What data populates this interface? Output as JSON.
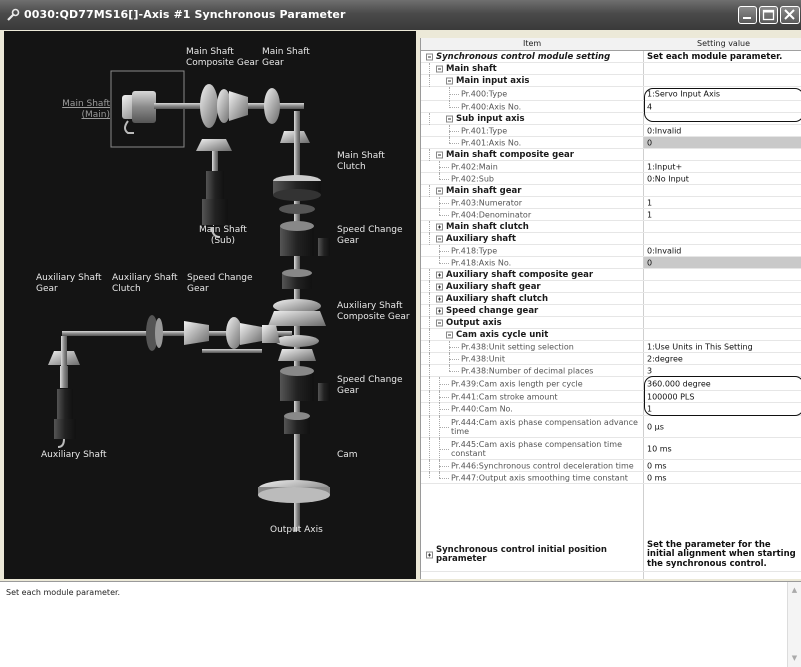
{
  "window": {
    "title": "0030:QD77MS16[]-Axis #1 Synchronous Parameter",
    "icon": "wrench-icon",
    "buttons": [
      "minimize-icon",
      "maximize-icon",
      "close-icon"
    ]
  },
  "diagram": {
    "labels": {
      "main_shaft_composite_gear": "Main Shaft\nComposite Gear",
      "main_shaft_gear": "Main Shaft\nGear",
      "main_shaft_main": "Main Shaft\n(Main)",
      "main_shaft_clutch": "Main Shaft\nClutch",
      "main_shaft_sub": "Main Shaft\n(Sub)",
      "speed_change_gear_top": "Speed Change\nGear",
      "auxiliary_shaft_gear": "Auxiliary Shaft\nGear",
      "auxiliary_shaft_clutch": "Auxiliary Shaft\nClutch",
      "speed_change_gear_aux": "Speed Change\nGear",
      "auxiliary_shaft_composite_gear": "Auxiliary Shaft\nComposite Gear",
      "speed_change_gear_bottom": "Speed Change\nGear",
      "auxiliary_shaft": "Auxiliary Shaft",
      "cam": "Cam",
      "output_axis": "Output Axis"
    }
  },
  "grid": {
    "headers": {
      "item": "Item",
      "value": "Setting value"
    },
    "rows": [
      {
        "label": "Synchronous control module setting",
        "value": "Set each module parameter."
      },
      {
        "label": "Main shaft",
        "value": ""
      },
      {
        "label": "Main input axis",
        "value": ""
      },
      {
        "label": "Pr.400:Type",
        "value": "1:Servo Input Axis"
      },
      {
        "label": "Pr.400:Axis No.",
        "value": "4"
      },
      {
        "label": "Sub input axis",
        "value": ""
      },
      {
        "label": "Pr.401:Type",
        "value": "0:Invalid"
      },
      {
        "label": "Pr.401:Axis No.",
        "value": "0"
      },
      {
        "label": "Main shaft composite gear",
        "value": ""
      },
      {
        "label": "Pr.402:Main",
        "value": "1:Input+"
      },
      {
        "label": "Pr.402:Sub",
        "value": "0:No Input"
      },
      {
        "label": "Main shaft gear",
        "value": ""
      },
      {
        "label": "Pr.403:Numerator",
        "value": "1"
      },
      {
        "label": "Pr.404:Denominator",
        "value": "1"
      },
      {
        "label": "Main shaft clutch",
        "value": ""
      },
      {
        "label": "Auxiliary shaft",
        "value": ""
      },
      {
        "label": "Pr.418:Type",
        "value": "0:Invalid"
      },
      {
        "label": "Pr.418:Axis No.",
        "value": "0"
      },
      {
        "label": "Auxiliary shaft composite gear",
        "value": ""
      },
      {
        "label": "Auxiliary shaft gear",
        "value": ""
      },
      {
        "label": "Auxiliary shaft clutch",
        "value": ""
      },
      {
        "label": "Speed change gear",
        "value": ""
      },
      {
        "label": "Output axis",
        "value": ""
      },
      {
        "label": "Cam axis cycle unit",
        "value": ""
      },
      {
        "label": "Pr.438:Unit setting selection",
        "value": "1:Use Units in This Setting"
      },
      {
        "label": "Pr.438:Unit",
        "value": "2:degree"
      },
      {
        "label": "Pr.438:Number of decimal places",
        "value": "3"
      },
      {
        "label": "Pr.439:Cam axis length per cycle",
        "value": "360.000 degree"
      },
      {
        "label": "Pr.441:Cam stroke amount",
        "value": "100000 PLS"
      },
      {
        "label": "Pr.440:Cam No.",
        "value": "1"
      },
      {
        "label": "Pr.444:Cam axis phase compensation advance time",
        "value": "0 µs"
      },
      {
        "label": "Pr.445:Cam axis phase compensation time constant",
        "value": "10 ms"
      },
      {
        "label": "Pr.446:Synchronous control deceleration time",
        "value": "0 ms"
      },
      {
        "label": "Pr.447:Output axis smoothing time constant",
        "value": "0 ms"
      },
      {
        "label": "Synchronous control initial position parameter",
        "value": "Set the parameter for the initial alignment when starting the synchronous control."
      }
    ]
  },
  "description": {
    "text": "Set each module parameter."
  }
}
